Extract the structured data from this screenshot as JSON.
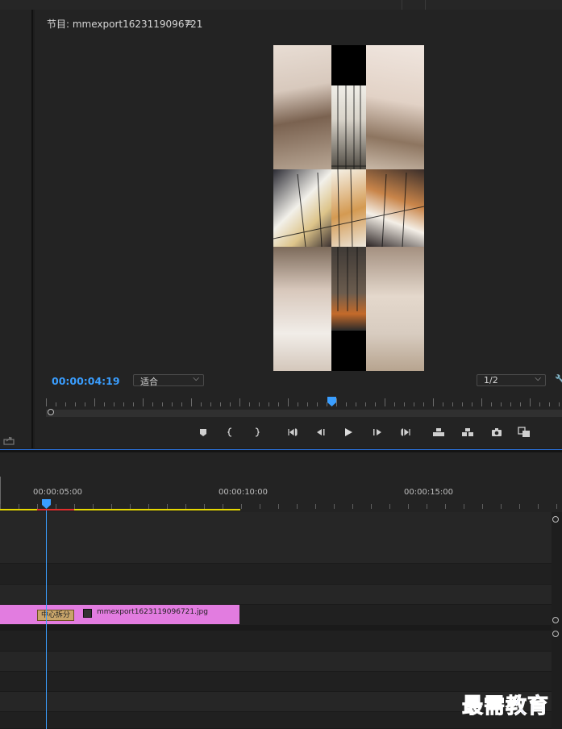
{
  "program_monitor": {
    "title": "节目: mmexport1623119096721",
    "menu_icon": "hamburger-menu-icon",
    "timecode": "00:00:04:19",
    "zoom_select": "适合",
    "resolution_select": "1/2",
    "settings_icon": "wrench-icon",
    "controls": [
      {
        "name": "add-marker-button",
        "icon": "marker-icon"
      },
      {
        "name": "mark-in-button",
        "icon": "mark-in-icon"
      },
      {
        "name": "mark-out-button",
        "icon": "mark-out-icon"
      },
      {
        "name": "go-to-in-button",
        "icon": "go-to-in-icon"
      },
      {
        "name": "step-back-button",
        "icon": "step-back-icon"
      },
      {
        "name": "play-button",
        "icon": "play-icon"
      },
      {
        "name": "step-forward-button",
        "icon": "step-forward-icon"
      },
      {
        "name": "go-to-out-button",
        "icon": "go-to-out-icon"
      },
      {
        "name": "lift-button",
        "icon": "lift-icon"
      },
      {
        "name": "extract-button",
        "icon": "extract-icon"
      },
      {
        "name": "export-frame-button",
        "icon": "camera-icon"
      },
      {
        "name": "comparison-view-button",
        "icon": "compare-icon"
      }
    ]
  },
  "timeline": {
    "ruler_labels": [
      "00:00:05:00",
      "00:00:10:00",
      "00:00:15:00"
    ],
    "clip": {
      "name": "mmexport1623119096721.jpg",
      "effect_badge": "中心拆分",
      "color": "#e27ce0"
    }
  },
  "watermark": "最需教育",
  "colors": {
    "timecode": "#3a9eff",
    "playhead": "#3a9eff",
    "work_area": "#e6d800",
    "render_bar": "#e02c2c"
  }
}
